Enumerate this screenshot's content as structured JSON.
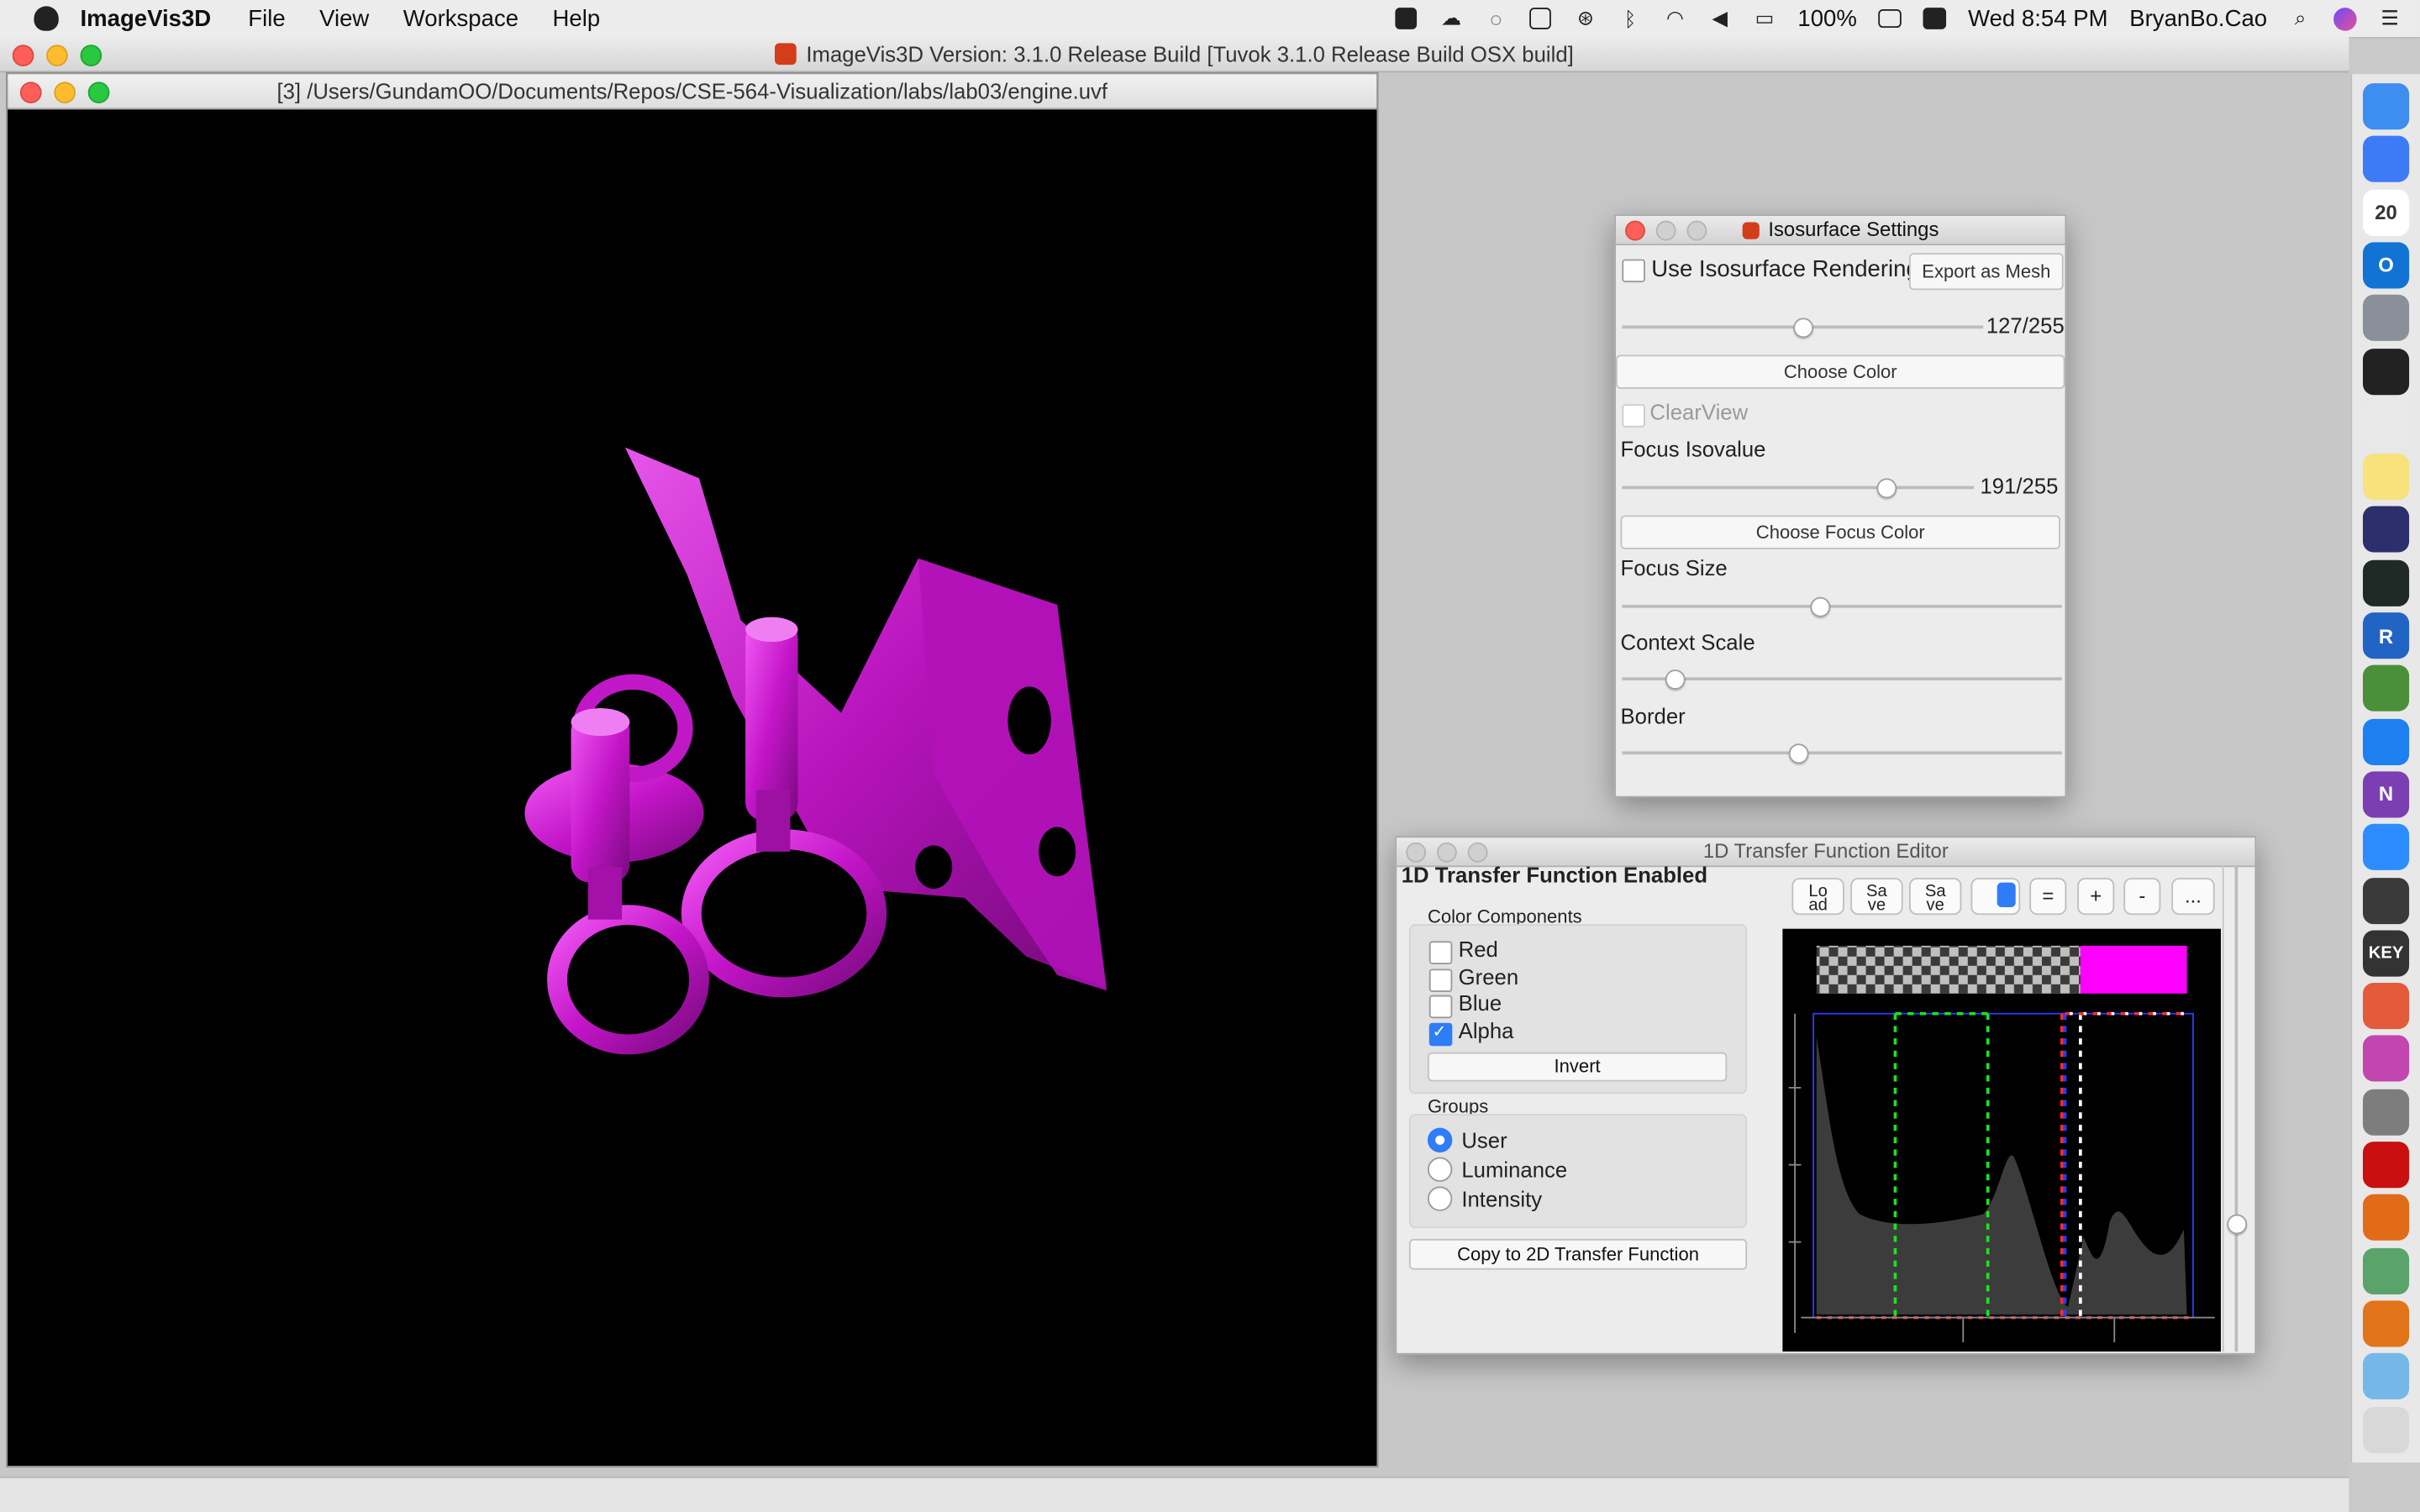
{
  "menubar": {
    "app_name": "ImageVis3D",
    "items": [
      "File",
      "View",
      "Workspace",
      "Help"
    ],
    "battery": "100%",
    "clock": "Wed 8:54 PM",
    "user": "BryanBo.Cao"
  },
  "main_window": {
    "title": "ImageVis3D Version: 3.1.0 Release Build [Tuvok 3.1.0 Release Build OSX build]"
  },
  "render_window": {
    "title": "[3] /Users/GundamOO/Documents/Repos/CSE-564-Visualization/labs/lab03/engine.uvf",
    "render_color": "#e21ee6"
  },
  "isosurface_settings": {
    "title": "Isosurface Settings",
    "use_iso_label": "Use Isosurface Rendering",
    "use_iso_checked": false,
    "export_mesh_label": "Export as Mesh",
    "isovalue_readout": "127/255",
    "isovalue_fraction": 0.498,
    "choose_color_label": "Choose Color",
    "clearview_label": "ClearView",
    "clearview_checked": false,
    "focus_isovalue_label": "Focus Isovalue",
    "focus_readout": "191/255",
    "focus_fraction": 0.749,
    "choose_focus_color_label": "Choose Focus Color",
    "focus_size_label": "Focus Size",
    "focus_size_fraction": 0.45,
    "context_scale_label": "Context Scale",
    "context_scale_fraction": 0.12,
    "border_label": "Border",
    "border_fraction": 0.4
  },
  "tf_editor": {
    "title": "1D Transfer Function Editor",
    "status": "1D Transfer Function Enabled",
    "color_components_label": "Color Components",
    "components": [
      {
        "label": "Red",
        "checked": false
      },
      {
        "label": "Green",
        "checked": false
      },
      {
        "label": "Blue",
        "checked": false
      },
      {
        "label": "Alpha",
        "checked": true
      }
    ],
    "invert_label": "Invert",
    "groups_label": "Groups",
    "groups": [
      {
        "label": "User",
        "selected": true
      },
      {
        "label": "Luminance",
        "selected": false
      },
      {
        "label": "Intensity",
        "selected": false
      }
    ],
    "copy_label": "Copy to 2D Transfer Function",
    "toolbar": {
      "load": "Lo\nad",
      "save": "Sa\nve",
      "save2": "Sa\nve",
      "equal": "=",
      "plus": "+",
      "minus": "-",
      "more": "..."
    },
    "preview_color": "#ff00ff"
  },
  "dock": {
    "icons": [
      "finder-icon",
      "paw-icon",
      "calendar-icon",
      "outlook-icon",
      "launchpad-icon",
      "terminal-icon",
      "chrome-icon",
      "notes-icon",
      "eclipse-icon",
      "activity-monitor-icon",
      "r-icon",
      "globe-icon",
      "teamviewer-icon",
      "onenote-icon",
      "zoom-icon",
      "quicktime-icon",
      "keynote-icon",
      "omnifocus-icon",
      "paint-icon",
      "system-preferences-icon",
      "acrobat-icon",
      "imagevis-icon",
      "atom-icon",
      "imagevis2-icon",
      "folder-icon",
      "trash-icon"
    ],
    "labels": {
      "calendar": "20",
      "outlook": "O",
      "r": "R",
      "onenote": "N",
      "keynote": "KEY"
    }
  }
}
